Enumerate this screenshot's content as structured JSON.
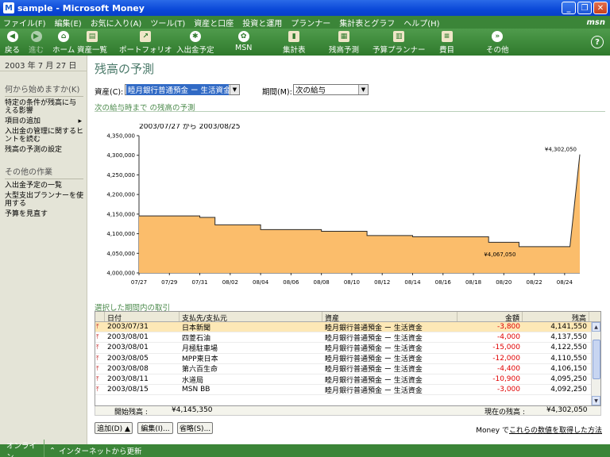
{
  "window": {
    "title": "sample - Microsoft Money",
    "app_icon": "M"
  },
  "menu": {
    "items": [
      "ファイル(F)",
      "編集(E)",
      "お気に入り(A)",
      "ツール(T)",
      "資産と口座",
      "投資と運用",
      "プランナー",
      "集計表とグラフ",
      "ヘルプ(H)"
    ],
    "brand": "msn"
  },
  "toolbar": {
    "back": "戻る",
    "forward": "進む",
    "home": "ホーム",
    "accounts": "資産一覧",
    "portfolio": "ポートフォリオ",
    "scheduled": "入出金予定",
    "msn": "MSN",
    "reports": "集計表",
    "forecast": "残高予測",
    "planner": "予算プランナー",
    "categories": "費目",
    "other": "その他",
    "help": "?"
  },
  "left": {
    "date": "2003 年 7 月 27 日",
    "section1": "何から始めますか(K)",
    "links1": [
      "特定の条件が残高に与える影響",
      "項目の追加",
      "入出金の管理に関するヒントを読む",
      "残高の予測の設定"
    ],
    "section2": "その他の作業",
    "links2": [
      "入出金予定の一覧",
      "大型支出プランナーを使用する",
      "予算を見直す"
    ]
  },
  "main": {
    "title": "残高の予測",
    "account_label": "資産(C):",
    "account_value": "睦月銀行普通預金 ー 生活資金",
    "period_label": "期間(M):",
    "period_value": "次の給与",
    "subtitle": "次の給与時まで の残高の予測",
    "tx_heading": "選択した期間内の取引"
  },
  "chart_data": {
    "type": "area",
    "title": "2003/07/27 から 2003/08/25",
    "x": [
      "07/27",
      "07/28",
      "07/29",
      "07/30",
      "07/31",
      "08/01",
      "08/02",
      "08/03",
      "08/04",
      "08/05",
      "08/06",
      "08/07",
      "08/08",
      "08/09",
      "08/10",
      "08/11",
      "08/12",
      "08/13",
      "08/14",
      "08/15",
      "08/16",
      "08/17",
      "08/18",
      "08/19",
      "08/20",
      "08/21",
      "08/22",
      "08/23",
      "08/24",
      "08/25"
    ],
    "values": [
      4145350,
      4145350,
      4145350,
      4145350,
      4141550,
      4122550,
      4122550,
      4122550,
      4110550,
      4110550,
      4110550,
      4110550,
      4106150,
      4106150,
      4106150,
      4095250,
      4095250,
      4095250,
      4092250,
      4092250,
      4092250,
      4092250,
      4092250,
      4078050,
      4078050,
      4067050,
      4067050,
      4067050,
      4067050,
      4302050
    ],
    "x_ticks": [
      "07/27",
      "07/29",
      "07/31",
      "08/02",
      "08/04",
      "08/06",
      "08/08",
      "08/10",
      "08/12",
      "08/14",
      "08/16",
      "08/18",
      "08/20",
      "08/22",
      "08/24"
    ],
    "y_ticks": [
      "4,000,000",
      "4,050,000",
      "4,100,000",
      "4,150,000",
      "4,200,000",
      "4,250,000",
      "4,300,000",
      "4,350,000"
    ],
    "ylim": [
      4000000,
      4350000
    ],
    "annotations": [
      {
        "x": "08/25",
        "label": "¥4,302,050"
      },
      {
        "x": "08/21",
        "label": "¥4,067,050"
      }
    ],
    "fill_color": "#fbbd6b",
    "line_color": "#2a2a2a",
    "grid": false
  },
  "table": {
    "columns": [
      "日付",
      "支払先/支払元",
      "資産",
      "金額",
      "残高"
    ],
    "rows": [
      {
        "date": "2003/07/31",
        "payee": "日本新聞",
        "account": "睦月銀行普通預金 ー 生活資金",
        "amount": "-3,800",
        "balance": "4,141,550"
      },
      {
        "date": "2003/08/01",
        "payee": "四菱石油",
        "account": "睦月銀行普通預金 ー 生活資金",
        "amount": "-4,000",
        "balance": "4,137,550"
      },
      {
        "date": "2003/08/01",
        "payee": "月極駐車場",
        "account": "睦月銀行普通預金 ー 生活資金",
        "amount": "-15,000",
        "balance": "4,122,550"
      },
      {
        "date": "2003/08/05",
        "payee": "MPP東日本",
        "account": "睦月銀行普通預金 ー 生活資金",
        "amount": "-12,000",
        "balance": "4,110,550"
      },
      {
        "date": "2003/08/08",
        "payee": "第六百生命",
        "account": "睦月銀行普通預金 ー 生活資金",
        "amount": "-4,400",
        "balance": "4,106,150"
      },
      {
        "date": "2003/08/11",
        "payee": "水道局",
        "account": "睦月銀行普通預金 ー 生活資金",
        "amount": "-10,900",
        "balance": "4,095,250"
      },
      {
        "date": "2003/08/15",
        "payee": "MSN BB",
        "account": "睦月銀行普通預金 ー 生活資金",
        "amount": "-3,000",
        "balance": "4,092,250"
      }
    ],
    "start_label": "開始残高 :",
    "start_value": "¥4,145,350",
    "end_label": "現在の残高 :",
    "end_value": "¥4,302,050"
  },
  "buttons": {
    "add": "追加(D) ▲",
    "edit": "編集(I)...",
    "skip": "省略(S)..."
  },
  "footer": {
    "prefix": "Money で",
    "link": "これらの数値を取得した方法"
  },
  "status": {
    "online": "オンライン",
    "update": "インターネットから更新"
  }
}
